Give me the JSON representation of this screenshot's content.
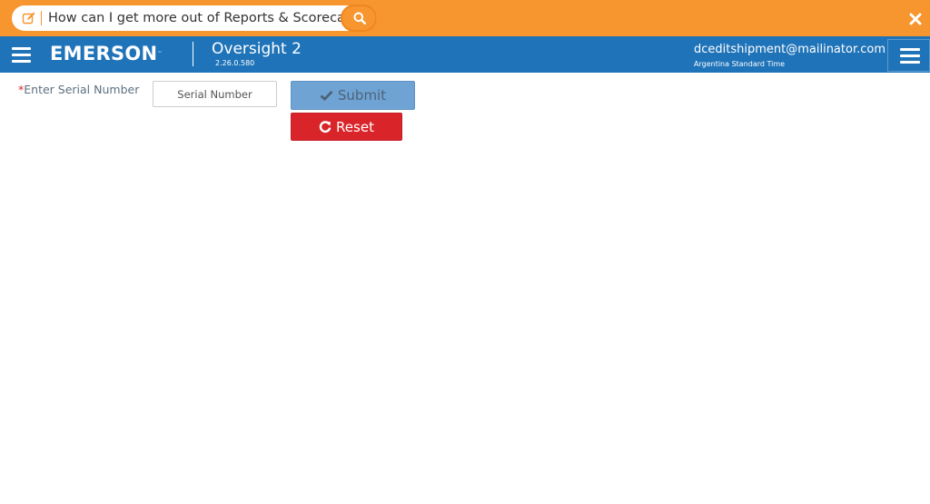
{
  "helpbar": {
    "search_text": "How can I get more out of Reports & Scorecards?",
    "search_icon": "search-icon",
    "edit_icon": "edit-icon",
    "close_icon": "close-icon",
    "color": "#f7952e"
  },
  "header": {
    "logo_text": "EMERSON",
    "logo_tm": "™",
    "app_title": "Oversight 2",
    "app_version": "2.26.0.580",
    "user_email": "dceditshipment@mailinator.com",
    "timezone": "Argentina Standard Time",
    "color": "#1f73b8"
  },
  "form": {
    "required_marker": "*",
    "serial_label": "Enter Serial Number",
    "serial_placeholder": "Serial Number",
    "serial_value": "",
    "submit_label": "Submit",
    "submit_icon": "check-icon",
    "reset_label": "Reset",
    "reset_icon": "refresh-icon",
    "reset_color": "#d9252a",
    "submit_color": "#6fa3d3"
  }
}
